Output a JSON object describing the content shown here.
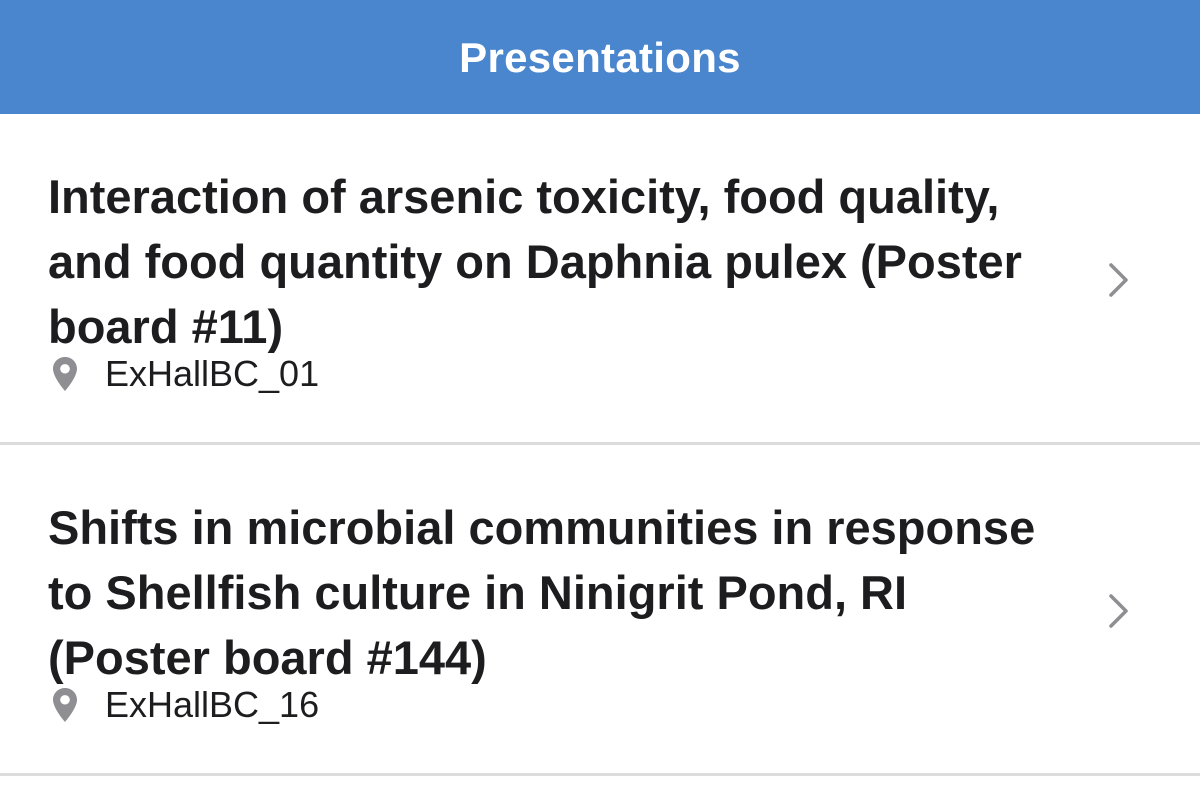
{
  "header": {
    "title": "Presentations"
  },
  "presentations": [
    {
      "title": "Interaction of arsenic toxicity, food quality, and food quantity on Daphnia pulex (Poster board #11)",
      "location": "ExHallBC_01"
    },
    {
      "title": "Shifts in microbial communities in response to Shellfish culture in Ninigrit Pond, RI (Poster board #144)",
      "location": "ExHallBC_16"
    }
  ],
  "icons": {
    "location": "map-pin-icon",
    "disclosure": "chevron-right-icon"
  },
  "colors": {
    "header_bg": "#4a86cd",
    "header_text": "#ffffff",
    "title_text": "#1d1d1f",
    "icon_gray": "#8e8e93",
    "divider": "#dcdcdc"
  }
}
